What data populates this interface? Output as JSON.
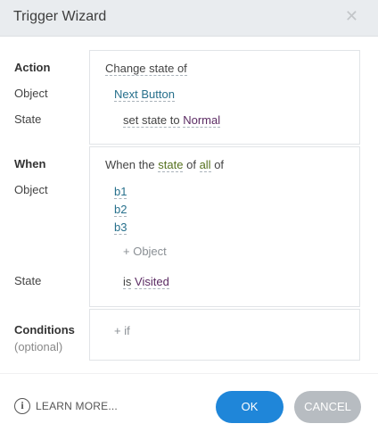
{
  "dialog": {
    "title": "Trigger Wizard",
    "close_glyph": "✕"
  },
  "action": {
    "labels": {
      "action": "Action",
      "object": "Object",
      "state": "State"
    },
    "verb": "Change state of",
    "object": "Next Button",
    "state_prefix": "set state to",
    "state_value": "Normal"
  },
  "when": {
    "labels": {
      "when": "When",
      "object": "Object",
      "state": "State"
    },
    "sentence": {
      "prefix": "When the",
      "state_word": "state",
      "of": "of",
      "all_word": "all",
      "suffix": "of"
    },
    "objects": [
      "b1",
      "b2",
      "b3"
    ],
    "add_object": "+ Object",
    "state_prefix": "is",
    "state_value": "Visited"
  },
  "conditions": {
    "label": "Conditions",
    "sublabel": "(optional)",
    "add_if": "+ if"
  },
  "footer": {
    "learn_more": "LEARN MORE...",
    "ok": "OK",
    "cancel": "CANCEL"
  },
  "colors": {
    "primary": "#1f86d9",
    "secondary": "#b7bcc1",
    "link": "#27708c",
    "state": "#5b2b63",
    "keyword": "#56721e"
  },
  "icons": {
    "close": "close-icon",
    "info": "info-icon"
  }
}
